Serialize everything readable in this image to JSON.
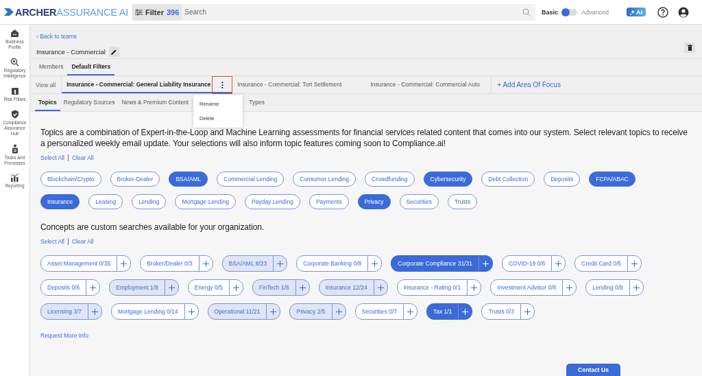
{
  "logo": {
    "primary": "ARCHER",
    "secondary": "ASSURANCE AI"
  },
  "search": {
    "filter_label": "Filter",
    "count": "396",
    "placeholder": "Search"
  },
  "mode_toggle": {
    "left_label": "Basic",
    "right_label": "Advanced",
    "advanced": false
  },
  "ai_button": {
    "label": "AI"
  },
  "sidebar": {
    "items": [
      {
        "label": "Business Profile",
        "selected": false
      },
      {
        "label": "Regulatory Intelligence",
        "selected": false
      },
      {
        "label": "Risk Pillars",
        "selected": false
      },
      {
        "label": "Compliance Assurance Hub",
        "selected": false
      },
      {
        "label": "Tasks and Processes",
        "selected": false
      },
      {
        "label": "Reporting",
        "selected": false
      }
    ]
  },
  "back_link": "‹ Back to teams",
  "team_name": "Insurance - Commercial",
  "tabs": [
    {
      "label": "Members",
      "selected": false
    },
    {
      "label": "Default Filters",
      "selected": true
    }
  ],
  "areas": {
    "view_all": "View all",
    "items": [
      {
        "label": "Insurance - Commercial: General Liability Insurance",
        "selected": true,
        "menu_open": true
      },
      {
        "label": "Insurance - Commercial: Tort Settlement",
        "selected": false,
        "menu_open": false
      },
      {
        "label": "Insurance - Commercial: Commercial Auto",
        "selected": false,
        "menu_open": false
      }
    ],
    "add_label": "+ Add Area Of Focus",
    "menu": [
      "Rename",
      "Delete"
    ]
  },
  "subtabs": [
    {
      "label": "Topics",
      "selected": true
    },
    {
      "label": "Regulatory Sources",
      "selected": false
    },
    {
      "label": "News & Premium Content",
      "selected": false
    },
    {
      "label": "Types",
      "selected": false
    }
  ],
  "topics": {
    "intro": "Topics are a combination of Expert-in-the-Loop and Machine Learning assessments for financial services related content that comes into our system. Select relevant topics to receive a personalized weekly email update. Your selections will also inform topic features coming soon to Compliance.ai!",
    "select_all": "Select All",
    "clear_all": "Clear All",
    "items": [
      {
        "label": "Blockchain/Crypto",
        "selected": false
      },
      {
        "label": "Broker-Dealer",
        "selected": false
      },
      {
        "label": "BSA/AML",
        "selected": true
      },
      {
        "label": "Commercial Lending",
        "selected": false
      },
      {
        "label": "Consumer Lending",
        "selected": false
      },
      {
        "label": "Crowdfunding",
        "selected": false
      },
      {
        "label": "Cybersecurity",
        "selected": true
      },
      {
        "label": "Debt Collection",
        "selected": false
      },
      {
        "label": "Deposits",
        "selected": false
      },
      {
        "label": "FCPA/ABAC",
        "selected": true
      },
      {
        "label": "Insurance",
        "selected": true
      },
      {
        "label": "Leasing",
        "selected": false
      },
      {
        "label": "Lending",
        "selected": false
      },
      {
        "label": "Mortgage Lending",
        "selected": false
      },
      {
        "label": "Payday Lending",
        "selected": false
      },
      {
        "label": "Payments",
        "selected": false
      },
      {
        "label": "Privacy",
        "selected": true
      },
      {
        "label": "Securities",
        "selected": false
      },
      {
        "label": "Trusts",
        "selected": false
      }
    ]
  },
  "concepts": {
    "intro": "Concepts are custom searches available for your organization.",
    "select_all": "Select All",
    "clear_all": "Clear All",
    "items": [
      {
        "label": "Asset Management 0/35",
        "selected": false,
        "partial": false
      },
      {
        "label": "Broker/Dealer 0/3",
        "selected": false,
        "partial": false
      },
      {
        "label": "BSA/AML 8/23",
        "selected": false,
        "partial": true
      },
      {
        "label": "Corporate Banking 0/8",
        "selected": false,
        "partial": false
      },
      {
        "label": "Corporate Compliance 31/31",
        "selected": true,
        "partial": false
      },
      {
        "label": "COVID-19 0/6",
        "selected": false,
        "partial": false
      },
      {
        "label": "Credit Card 0/5",
        "selected": false,
        "partial": false
      },
      {
        "label": "Deposits 0/6",
        "selected": false,
        "partial": false
      },
      {
        "label": "Employment 1/8",
        "selected": false,
        "partial": true
      },
      {
        "label": "Energy 0/5",
        "selected": false,
        "partial": false
      },
      {
        "label": "FinTech 1/6",
        "selected": false,
        "partial": true
      },
      {
        "label": "Insurance 12/24",
        "selected": false,
        "partial": true
      },
      {
        "label": "Insurance - Rating 0/1",
        "selected": false,
        "partial": false
      },
      {
        "label": "Investment Advisor 0/8",
        "selected": false,
        "partial": false
      },
      {
        "label": "Lending 0/8",
        "selected": false,
        "partial": false
      },
      {
        "label": "Licensing 3/7",
        "selected": false,
        "partial": true
      },
      {
        "label": "Mortgage Lending 0/14",
        "selected": false,
        "partial": false
      },
      {
        "label": "Operational 11/21",
        "selected": false,
        "partial": true
      },
      {
        "label": "Privacy 2/5",
        "selected": false,
        "partial": true
      },
      {
        "label": "Securities 0/7",
        "selected": false,
        "partial": false
      },
      {
        "label": "Tax 1/1",
        "selected": true,
        "partial": false
      },
      {
        "label": "Trusts 0/3",
        "selected": false,
        "partial": false
      }
    ]
  },
  "request_link": "Request More Info",
  "contact_button": "Contact Us"
}
